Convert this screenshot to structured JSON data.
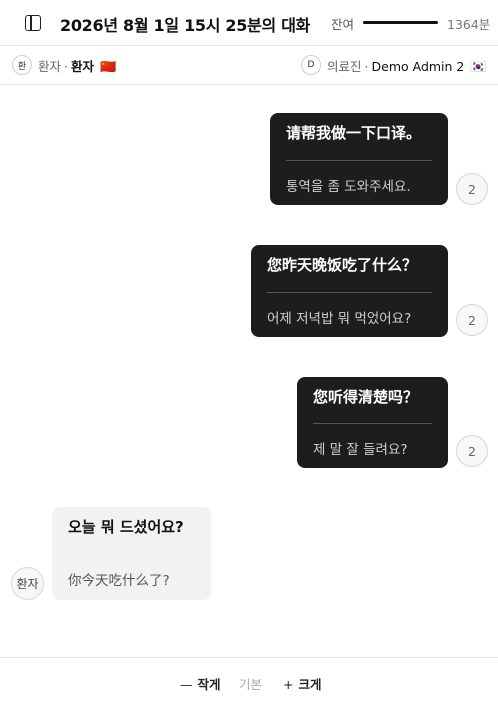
{
  "header": {
    "title": "2026년 8월 1일 15시 25분의 대화",
    "remaining_label": "잔여",
    "remaining_value": "1364분",
    "remaining_fraction": 1.0
  },
  "participants": {
    "patient": {
      "avatar": "환",
      "role": "환자",
      "name": "환자",
      "flag": "🇨🇳"
    },
    "staff": {
      "avatar": "D",
      "role": "의료진",
      "name": "Demo Admin 2",
      "flag": "🇰🇷"
    }
  },
  "messages": [
    {
      "side": "me",
      "primary": "请帮我做一下口译。",
      "secondary": "통역을 좀 도와주세요.",
      "count": "2"
    },
    {
      "side": "me",
      "primary": "您昨天晚饭吃了什么？",
      "secondary": "어제 저녁밥 뭐 먹었어요?",
      "count": "2"
    },
    {
      "side": "me",
      "primary": "您听得清楚吗？",
      "secondary": "제 말 잘 들려요?",
      "count": "2"
    },
    {
      "side": "them",
      "avatar": "환자",
      "primary": "오늘 뭐 드셨어요?",
      "secondary": "你今天吃什么了?"
    }
  ],
  "footer": {
    "smaller_symbol": "—",
    "smaller_label": "작게",
    "default_label": "기본",
    "larger_symbol": "+",
    "larger_label": "크게"
  }
}
